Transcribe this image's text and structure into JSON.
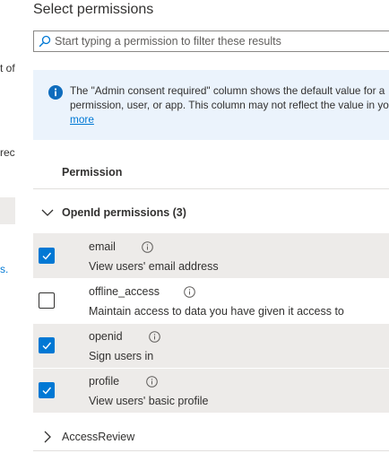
{
  "background": {
    "fragment_1": "t of",
    "fragment_2": "rec",
    "fragment_3": "s."
  },
  "panel": {
    "title": "Select permissions",
    "search": {
      "placeholder": "Start typing a permission to filter these results",
      "value": ""
    },
    "info": {
      "text": "The \"Admin consent required\" column shows the default value for an organization. However, user consent can be customized per permission, user, or app. This column may not reflect the value in your organization, or in organizations where this app will be used.",
      "line1": "The \"Admin consent required\" column shows the default value for a",
      "line2": "permission, user, or app. This column may not reflect the value in yo",
      "link": "more"
    },
    "column_header": "Permission",
    "groups": [
      {
        "label": "OpenId permissions (3)",
        "expanded": true,
        "items": [
          {
            "name": "email",
            "description": "View users' email address",
            "checked": true
          },
          {
            "name": "offline_access",
            "description": "Maintain access to data you have given it access to",
            "checked": false
          },
          {
            "name": "openid",
            "description": "Sign users in",
            "checked": true
          },
          {
            "name": "profile",
            "description": "View users' basic profile",
            "checked": true
          }
        ]
      },
      {
        "label": "AccessReview",
        "expanded": false
      }
    ]
  },
  "colors": {
    "accent": "#0078d4",
    "info_bg": "#ebf3fc",
    "selected_row": "#edebe9"
  }
}
